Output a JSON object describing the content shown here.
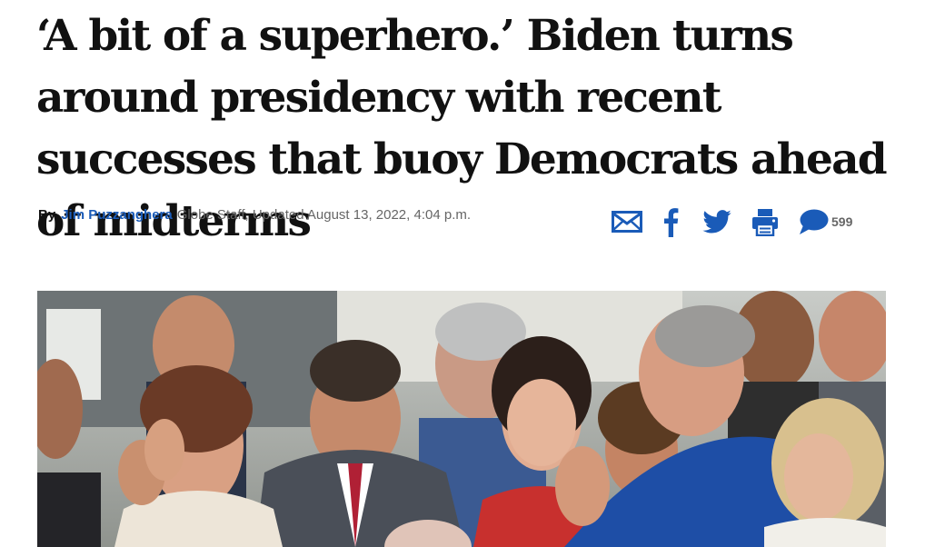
{
  "article": {
    "headline": "‘A bit of a superhero.’ Biden turns around presidency with recent successes that buoy Democrats ahead of midterms",
    "byline": {
      "by_label": "By",
      "author": "Jim Puzzanghera",
      "meta": "Globe Staff, Updated August 13, 2022, 4:04 p.m."
    }
  },
  "share_bar": {
    "icons": [
      "email-icon",
      "facebook-icon",
      "twitter-icon",
      "print-icon",
      "comment-icon"
    ],
    "comment_count": "599",
    "icon_color": "#1a5bb8"
  },
  "photo": {
    "description_icon": "photo"
  },
  "colors": {
    "headline": "#111111",
    "author_link": "#1a5bb8",
    "meta_text": "#666666"
  }
}
